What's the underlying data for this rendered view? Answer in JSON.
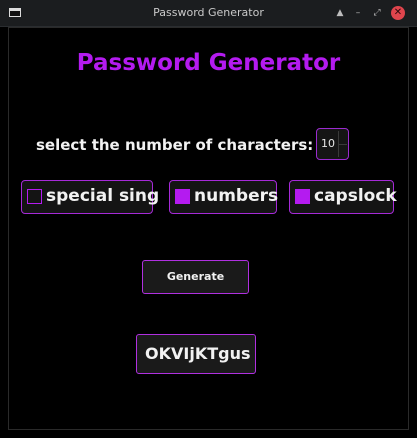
{
  "window": {
    "title": "Password Generator",
    "app_icon": "window-icon",
    "controls": [
      "keep-above-icon",
      "minimize-icon",
      "maximize-icon",
      "close-icon"
    ],
    "keep_above_glyph": "▲",
    "minimize_glyph": "–",
    "maximize_glyph": "⤢",
    "close_glyph": "✕"
  },
  "main": {
    "heading": "Password Generator",
    "count_label": "select the number of characters:",
    "count_value": "10",
    "options": [
      {
        "label": "special sing",
        "checked": false
      },
      {
        "label": "numbers",
        "checked": true
      },
      {
        "label": "capslock",
        "checked": true
      }
    ],
    "generate_label": "Generate",
    "result": "OKVIjKTgus"
  },
  "colors": {
    "accent": "#b41bf0",
    "background": "#000000",
    "text": "#f2f2f2",
    "titlebar": "#1b1d1f"
  }
}
